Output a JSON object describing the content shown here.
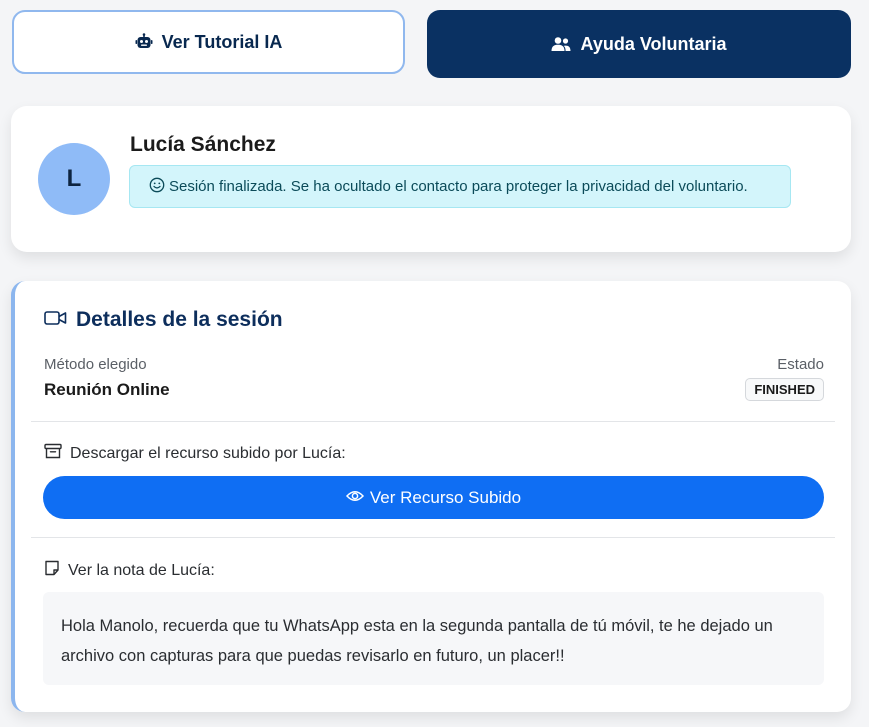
{
  "header": {
    "tutorial_button": {
      "label": "Ver Tutorial IA",
      "icon": "robot-icon"
    },
    "ayuda_button": {
      "label": "Ayuda Voluntaria",
      "icon": "users-icon"
    }
  },
  "profile": {
    "avatar_initial": "L",
    "name": "Lucía Sánchez",
    "alert": {
      "icon": "smile-icon",
      "text": "Sesión finalizada. Se ha ocultado el contacto para proteger la privacidad del voluntario."
    }
  },
  "details": {
    "title": "Detalles de la sesión",
    "title_icon": "video-camera-icon",
    "metodo_label": "Método elegido",
    "metodo_value": "Reunión Online",
    "estado_label": "Estado",
    "estado_value": "FINISHED",
    "resource": {
      "icon": "archive-icon",
      "label": "Descargar el recurso subido por Lucía:",
      "button_label": "Ver Recurso Subido",
      "button_icon": "eye-icon"
    },
    "note": {
      "icon": "sticky-note-icon",
      "label": "Ver la nota de Lucía:",
      "text": "Hola Manolo, recuerda que tu WhatsApp esta en la segunda pantalla de tú móvil, te he dejado un archivo con capturas para que puedas revisarlo en futuro, un placer!!"
    }
  },
  "colors": {
    "navy": "#0a3162",
    "primary_blue": "#0f6ef3",
    "avatar_blue": "#8fbbf7",
    "alert_bg": "#d3f5fb",
    "accent_border": "#8cb6ee"
  }
}
